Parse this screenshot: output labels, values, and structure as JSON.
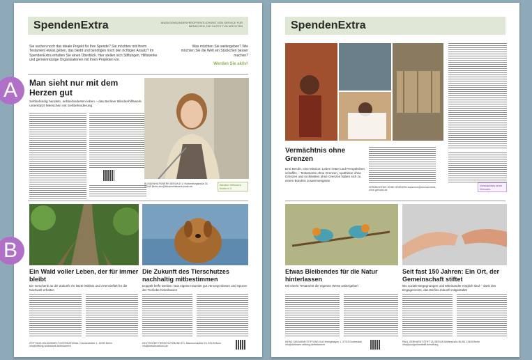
{
  "masthead": {
    "title": "SpendenExtra",
    "subtitle": "ANZEIGENSONDERVERÖFFENTLICHUNG VON SERVICE FÜR MENSCHEN, DIE GUTES TUN MÖCHTEN"
  },
  "intro": {
    "left": "Sie suchen noch das ideale Projekt für Ihre Spende? Sie möchten mit Ihrem Testament etwas geben, das bleibt und benötigen noch den richtigen Ansatz? Im SpendenExtra erhalten Sie einen Überblick. Hier stellen sich Stiftungen, Hilfswerke und gemeinnützige Organisationen mit ihren Projekten vor.",
    "right_q": "Was möchten Sie weitergeben? Wie möchten Sie die Welt ein Stückchen besser machen?",
    "right_cta": "Werden Sie aktiv!"
  },
  "badges": {
    "a": "A",
    "b": "B"
  },
  "article_a": {
    "headline": "Man sieht nur mit dem Herzen gut",
    "lead": "Sehbehindig handeln, sehbehinderten leben – das Berliner Blindenhilfswerk unterstützt Menschen mit Sehbehinderung",
    "foot": "BLINDENHILFSWERK BERLIN E.V. Rothenburgstraße 15, 12165 Berlin info@blindenhilfswerk-berlin.de",
    "logo": "Blinden Hilfswerk Berlin e.V."
  },
  "article_b1": {
    "headline": "Ein Wald voller Leben, der für immer bleibt",
    "lead": "Ein Geschenk an die Zukunft: Ihr letzte Wildnis und Artenvielfalt für die Nachwelt erhalten",
    "foot": "STIFTUNG WILDNISWELT INTERNATIONAL Oranienstraße 1, 10999 Berlin info@stiftung-wildniswelt.de/testament"
  },
  "article_b2": {
    "headline": "Die Zukunft des Tierschutzes nachhaltig mitbestimmen",
    "lead": "Doppelt helfe werden: Das eigene Haustier gut versorgt wissen und Spuren der Tierliebe hinterlassen",
    "foot": "DEUTSCHER TIERSCHUTZBUND E.V. Baumschulallee 15, 53115 Bonn info@tierschutzbund.de"
  },
  "p2_article": {
    "headline": "Vermächtnis ohne Grenzen",
    "lead": "Drei Berufe, eine Mission: Leben retten und Perspektiven schaffen – Testamente ohne Grenzen, Apotheker ohne Grenzen und Architekten ohne Grenzen haben sich zu einem Bündnis zusammengetan",
    "foot": "VERMÄCHTNIS OHNE GRENZEN testament@vermaechtnis-ohne-grenzen.de",
    "logo": "Vermächtnis ohne Grenzen"
  },
  "p2_b1": {
    "headline": "Etwas Bleibendes für die Natur hinterlassen",
    "lead": "Mit einem Testament die eigenen Werte weitergeben",
    "foot": "HEINZ SIELMANN STIFTUNG Gut Herbigshagen 1, 37115 Duderstadt info@sielmann-stiftung.de/testament"
  },
  "p2_b2": {
    "headline": "Seit fast 150 Jahren: Ein Ort, der Gemeinschaft stiftet",
    "lead": "Wo soziale Begegnungen und Miteinander möglich sind – dank des Engagements, das Berlins Zukunft mitgestaltet",
    "foot": "PAUL GERHARDT STIFT ZU BERLIN Müllerstraße 56-58, 13349 Berlin info@paulgerhardtstift.de/stiftung"
  },
  "colors": {
    "masthead_bg": "#dfe8d4",
    "badge": "#b070c8",
    "accent_green": "#8fb24a"
  }
}
